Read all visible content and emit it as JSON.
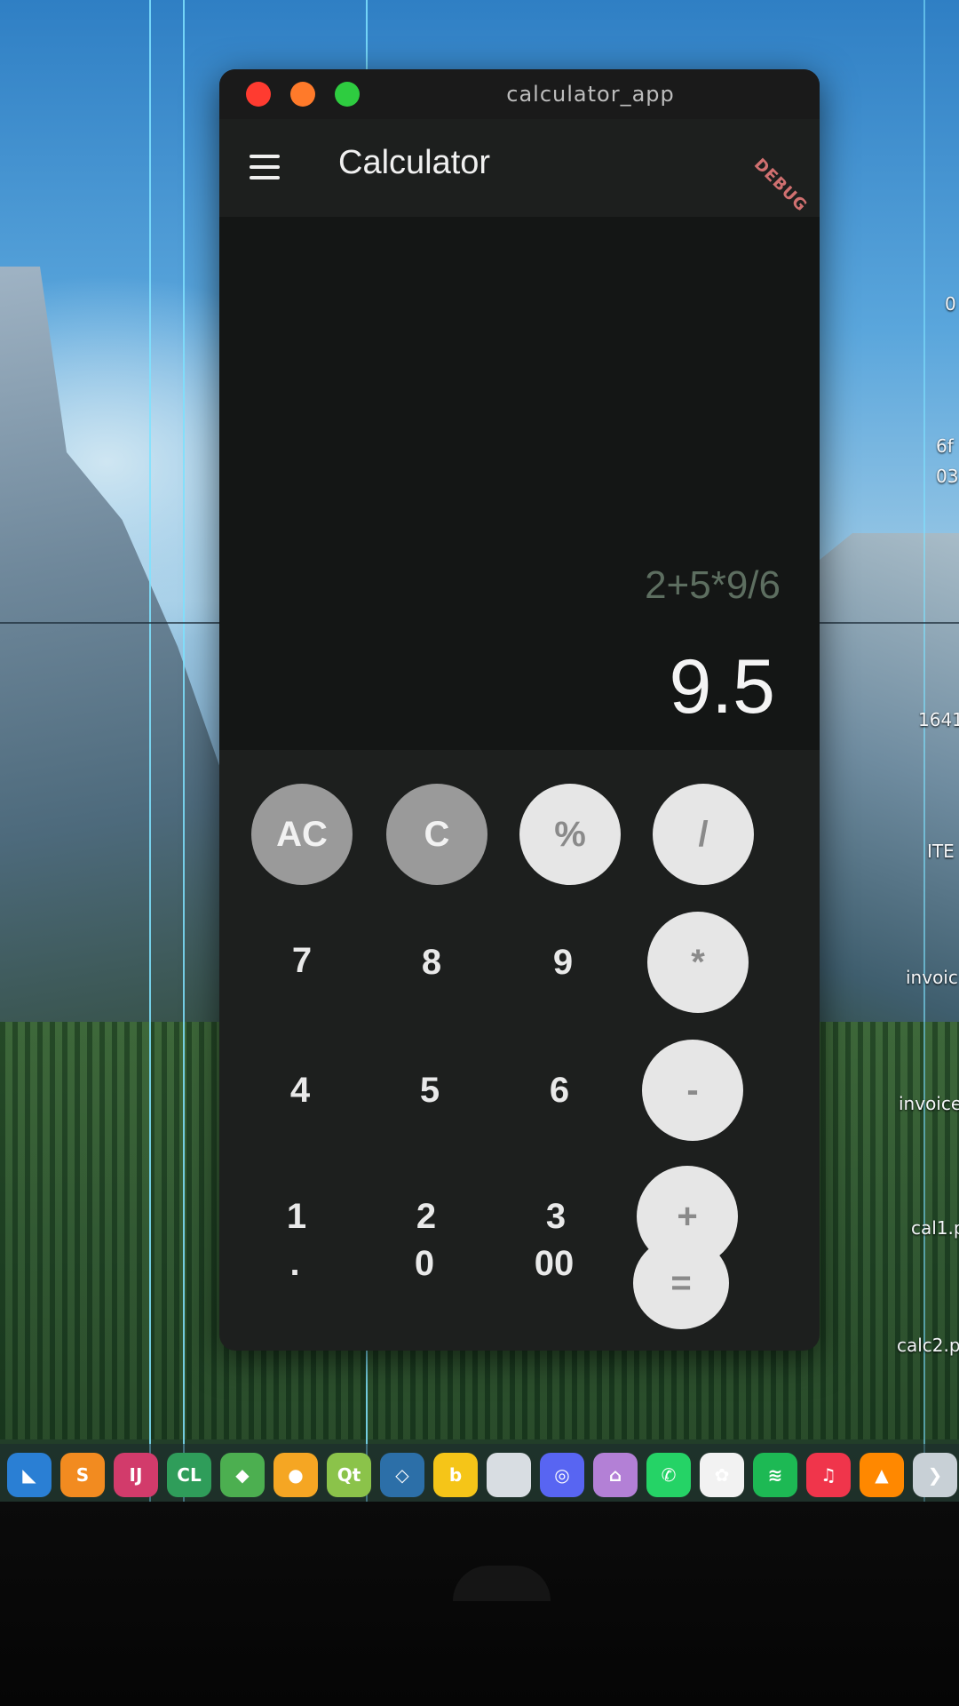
{
  "window": {
    "title": "calculator_app"
  },
  "appbar": {
    "title": "Calculator",
    "debug_banner": "DEBUG"
  },
  "display": {
    "expression": "2+5*9/6",
    "result": "9.5"
  },
  "keypad": {
    "rows": [
      [
        {
          "label": "AC",
          "style": "grey"
        },
        {
          "label": "C",
          "style": "grey"
        },
        {
          "label": "%",
          "style": "light"
        },
        {
          "label": "/",
          "style": "light"
        }
      ],
      [
        {
          "label": "7",
          "style": "num"
        },
        {
          "label": "8",
          "style": "num"
        },
        {
          "label": "9",
          "style": "num"
        },
        {
          "label": "*",
          "style": "light"
        }
      ],
      [
        {
          "label": "4",
          "style": "num"
        },
        {
          "label": "5",
          "style": "num"
        },
        {
          "label": "6",
          "style": "num"
        },
        {
          "label": "-",
          "style": "light"
        }
      ],
      [
        {
          "label": "1",
          "style": "num"
        },
        {
          "label": "2",
          "style": "num"
        },
        {
          "label": "3",
          "style": "num"
        },
        {
          "label": "+",
          "style": "light"
        }
      ],
      [
        {
          "label": ".",
          "style": "num"
        },
        {
          "label": "0",
          "style": "num"
        },
        {
          "label": "00",
          "style": "num"
        },
        {
          "label": "=",
          "style": "light"
        }
      ]
    ]
  },
  "desktop_labels": {
    "label_1": "0",
    "label_2": "6f",
    "label_3": "03",
    "label_4": "1641",
    "label_5": "ITE",
    "label_6": "invoic",
    "label_7": "invoice",
    "label_8": "cal1.p",
    "label_9": "calc2.p"
  },
  "dock": {
    "icons": [
      {
        "name": "vscode-icon",
        "glyph": "◣",
        "color": "#2a7fd4"
      },
      {
        "name": "sublime-icon",
        "glyph": "S",
        "color": "#f28b20"
      },
      {
        "name": "intellij-icon",
        "glyph": "IJ",
        "color": "#d23b6b"
      },
      {
        "name": "clion-icon",
        "glyph": "CL",
        "color": "#2f9d5a"
      },
      {
        "name": "maps-icon",
        "glyph": "◆",
        "color": "#4caf50"
      },
      {
        "name": "postman-icon",
        "glyph": "●",
        "color": "#f5a623"
      },
      {
        "name": "qt-icon",
        "glyph": "Qt",
        "color": "#8bc34a"
      },
      {
        "name": "mysql-workbench-icon",
        "glyph": "◇",
        "color": "#2c6fa8"
      },
      {
        "name": "b-app-icon",
        "glyph": "b",
        "color": "#f5c518"
      },
      {
        "name": "blank-app-icon",
        "glyph": "",
        "color": "#d8dde2"
      },
      {
        "name": "discord-icon",
        "glyph": "◎",
        "color": "#5865f2"
      },
      {
        "name": "github-icon",
        "glyph": "⌂",
        "color": "#b380d6"
      },
      {
        "name": "whatsapp-icon",
        "glyph": "✆",
        "color": "#25d366"
      },
      {
        "name": "photos-icon",
        "glyph": "✿",
        "color": "#f2f2f2"
      },
      {
        "name": "spotify-icon",
        "glyph": "≋",
        "color": "#1db954"
      },
      {
        "name": "music-icon",
        "glyph": "♫",
        "color": "#f0354b"
      },
      {
        "name": "vlc-icon",
        "glyph": "▲",
        "color": "#ff8800"
      },
      {
        "name": "chevron-right-icon",
        "glyph": "❯",
        "color": "#c8d0d6"
      }
    ]
  }
}
